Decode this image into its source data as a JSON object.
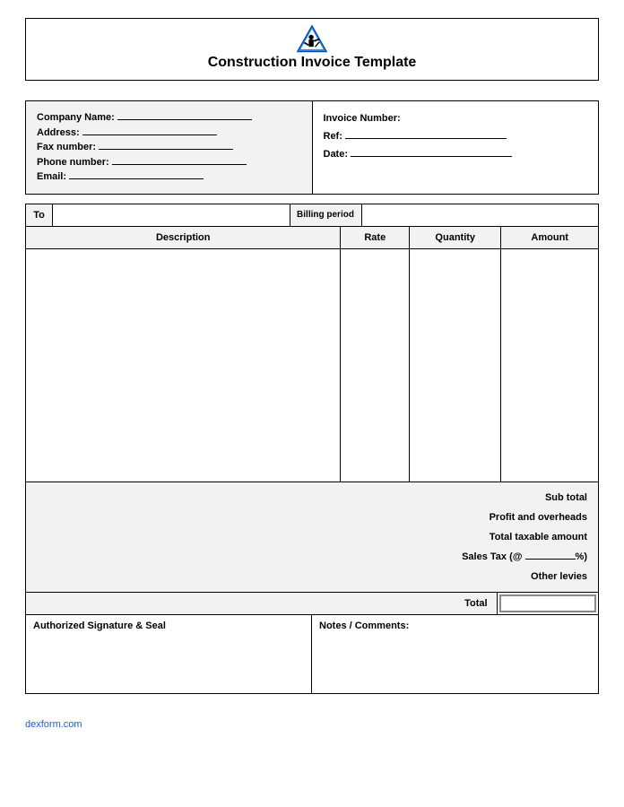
{
  "title": "Construction Invoice Template",
  "company": {
    "name_label": "Company Name:",
    "address_label": "Address:",
    "fax_label": "Fax number:",
    "phone_label": "Phone number:",
    "email_label": "Email:"
  },
  "invoice": {
    "number_label": "Invoice Number:",
    "ref_label": "Ref:",
    "date_label": "Date:"
  },
  "to_label": "To",
  "billing_period_label": "Billing period",
  "columns": {
    "description": "Description",
    "rate": "Rate",
    "quantity": "Quantity",
    "amount": "Amount"
  },
  "summary": {
    "subtotal": "Sub total",
    "profit": "Profit and overheads",
    "taxable": "Total taxable amount",
    "sales_tax": "Sales Tax (@",
    "sales_tax_suffix": "%)",
    "levies": "Other levies",
    "total": "Total"
  },
  "footer": {
    "signature": "Authorized Signature & Seal",
    "notes": "Notes / Comments:"
  },
  "link": "dexform.com"
}
